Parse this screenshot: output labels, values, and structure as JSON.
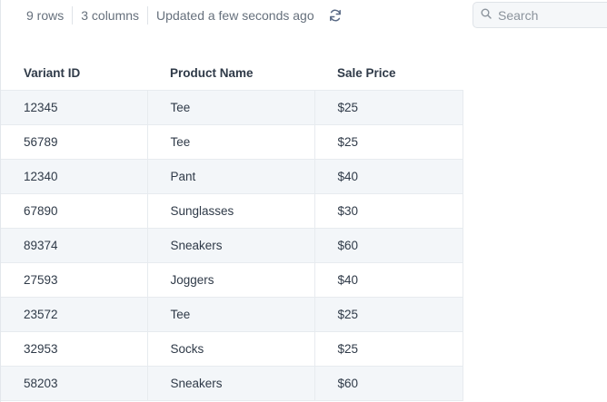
{
  "toolbar": {
    "row_count": "9 rows",
    "column_count": "3 columns",
    "updated": "Updated a few seconds ago",
    "refresh_icon": "refresh-icon"
  },
  "search": {
    "placeholder": "Search",
    "value": ""
  },
  "table": {
    "columns": [
      "Variant ID",
      "Product Name",
      "Sale Price"
    ],
    "rows": [
      [
        "12345",
        "Tee",
        "$25"
      ],
      [
        "56789",
        "Tee",
        "$25"
      ],
      [
        "12340",
        "Pant",
        "$40"
      ],
      [
        "67890",
        "Sunglasses",
        "$30"
      ],
      [
        "89374",
        "Sneakers",
        "$60"
      ],
      [
        "27593",
        "Joggers",
        "$40"
      ],
      [
        "23572",
        "Tee",
        "$25"
      ],
      [
        "32953",
        "Socks",
        "$25"
      ],
      [
        "58203",
        "Sneakers",
        "$60"
      ]
    ]
  }
}
